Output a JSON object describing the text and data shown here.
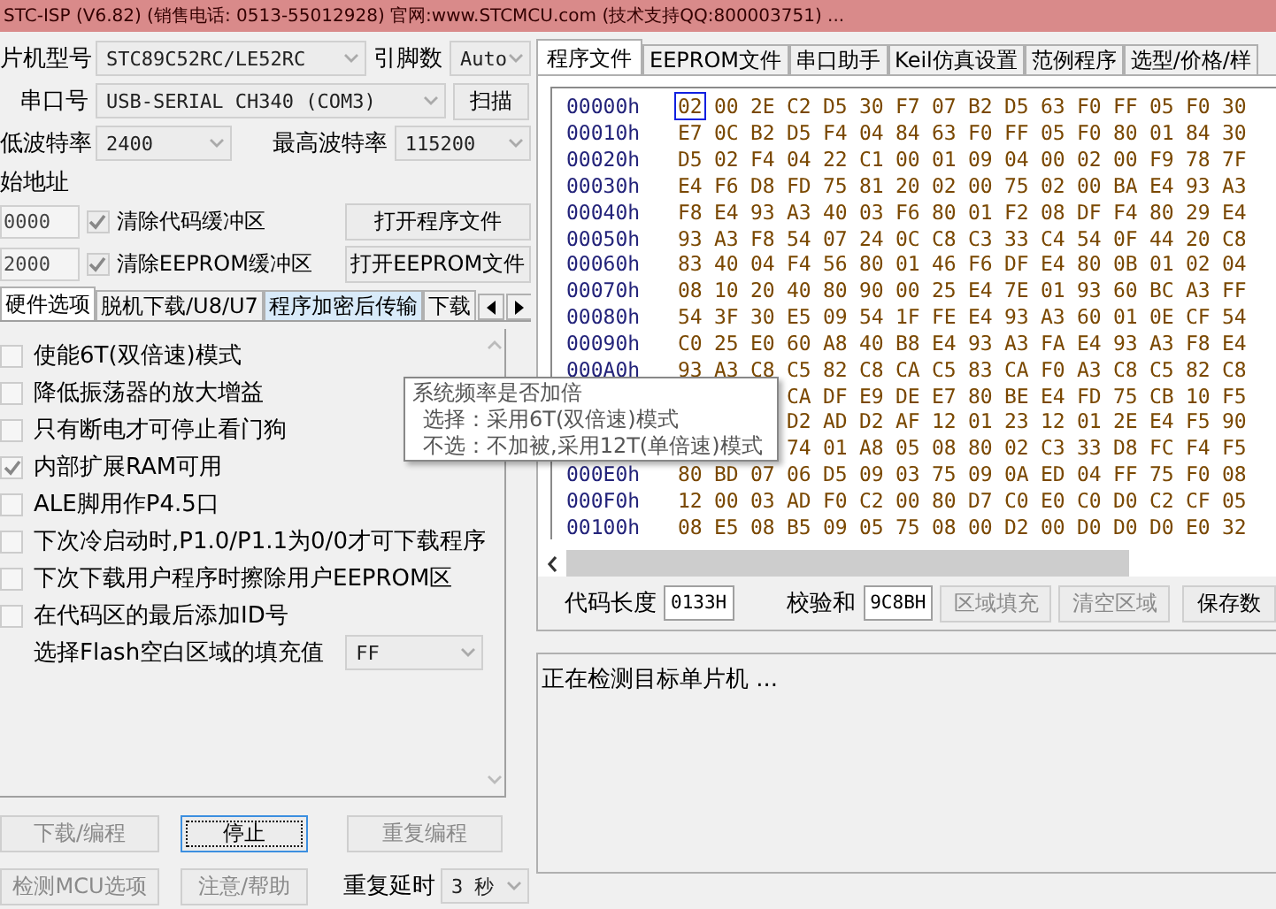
{
  "title": "STC-ISP (V6.82) (销售电话: 0513-55012928) 官网:www.STCMCU.com (技术支持QQ:800003751) ...",
  "chip": {
    "label": "片机型号",
    "value": "STC89C52RC/LE52RC"
  },
  "pins": {
    "label": "引脚数",
    "value": "Auto"
  },
  "port": {
    "label": "串口号",
    "value": "USB-SERIAL CH340 (COM3)",
    "button": "扫描"
  },
  "min_baud": {
    "label": "低波特率",
    "value": "2400"
  },
  "max_baud": {
    "label": "最高波特率",
    "value": "115200"
  },
  "start_address": {
    "label": "始地址",
    "rows": [
      {
        "value": "0000",
        "option": "清除代码缓冲区",
        "checked": true,
        "button": "打开程序文件"
      },
      {
        "value": "2000",
        "option": "清除EEPROM缓冲区",
        "checked": true,
        "button": "打开EEPROM文件"
      }
    ]
  },
  "left_tabs": [
    {
      "label": "硬件选项",
      "selected": true,
      "hovered": false
    },
    {
      "label": "脱机下载/U8/U7",
      "selected": false,
      "hovered": false
    },
    {
      "label": "程序加密后传输",
      "selected": false,
      "hovered": true
    },
    {
      "label": "下载",
      "selected": false,
      "hovered": false
    }
  ],
  "options": [
    {
      "kind": "checkbox",
      "label": "使能6T(双倍速)模式",
      "checked": false
    },
    {
      "kind": "checkbox",
      "label": "降低振荡器的放大增益",
      "checked": false
    },
    {
      "kind": "checkbox",
      "label": "只有断电才可停止看门狗",
      "checked": false
    },
    {
      "kind": "checkbox",
      "label": "内部扩展RAM可用",
      "checked": true
    },
    {
      "kind": "checkbox",
      "label": "ALE脚用作P4.5口",
      "checked": false
    },
    {
      "kind": "checkbox",
      "label": "下次冷启动时,P1.0/P1.1为0/0才可下载程序",
      "checked": false
    },
    {
      "kind": "checkbox",
      "label": "下次下载用户程序时擦除用户EEPROM区",
      "checked": false
    },
    {
      "kind": "checkbox",
      "label": "在代码区的最后添加ID号",
      "checked": false
    },
    {
      "kind": "select",
      "label": "选择Flash空白区域的填充值",
      "value": "FF"
    }
  ],
  "tooltip": {
    "title": "系统频率是否加倍",
    "lines": [
      "选择：采用6T(双倍速)模式",
      "不选：不加被,采用12T(单倍速)模式"
    ]
  },
  "actions": [
    {
      "label": "下载/编程",
      "disabled": true,
      "focused": false
    },
    {
      "label": "停止",
      "disabled": false,
      "focused": true
    },
    {
      "label": "重复编程",
      "disabled": true,
      "focused": false
    },
    {
      "label": "检测MCU选项",
      "disabled": true,
      "focused": false
    },
    {
      "label": "注意/帮助",
      "disabled": true,
      "focused": false
    }
  ],
  "repeat_delay": {
    "label": "重复延时",
    "value": "3 秒"
  },
  "right_tabs": [
    {
      "label": "程序文件",
      "selected": true
    },
    {
      "label": "EEPROM文件",
      "selected": false
    },
    {
      "label": "串口助手",
      "selected": false
    },
    {
      "label": "Keil仿真设置",
      "selected": false
    },
    {
      "label": "范例程序",
      "selected": false
    },
    {
      "label": "选型/价格/样",
      "selected": false
    }
  ],
  "hex": {
    "rows": [
      {
        "offset": "00000h",
        "cursor": true,
        "cells": [
          "02",
          "00",
          "2E",
          "C2",
          "D5",
          "30",
          "F7",
          "07",
          "B2",
          "D5",
          "63",
          "F0",
          "FF",
          "05",
          "F0",
          "30"
        ]
      },
      {
        "offset": "00010h",
        "cursor": false,
        "cells": [
          "E7",
          "0C",
          "B2",
          "D5",
          "F4",
          "04",
          "84",
          "63",
          "F0",
          "FF",
          "05",
          "F0",
          "80",
          "01",
          "84",
          "30"
        ]
      },
      {
        "offset": "00020h",
        "cursor": false,
        "cells": [
          "D5",
          "02",
          "F4",
          "04",
          "22",
          "C1",
          "00",
          "01",
          "09",
          "04",
          "00",
          "02",
          "00",
          "F9",
          "78",
          "7F"
        ]
      },
      {
        "offset": "00030h",
        "cursor": false,
        "cells": [
          "E4",
          "F6",
          "D8",
          "FD",
          "75",
          "81",
          "20",
          "02",
          "00",
          "75",
          "02",
          "00",
          "BA",
          "E4",
          "93",
          "A3"
        ]
      },
      {
        "offset": "00040h",
        "cursor": false,
        "cells": [
          "F8",
          "E4",
          "93",
          "A3",
          "40",
          "03",
          "F6",
          "80",
          "01",
          "F2",
          "08",
          "DF",
          "F4",
          "80",
          "29",
          "E4"
        ]
      },
      {
        "offset": "00050h",
        "cursor": false,
        "cells": [
          "93",
          "A3",
          "F8",
          "54",
          "07",
          "24",
          "0C",
          "C8",
          "C3",
          "33",
          "C4",
          "54",
          "0F",
          "44",
          "20",
          "C8"
        ]
      },
      {
        "offset": "00060h",
        "cursor": false,
        "cells": [
          "83",
          "40",
          "04",
          "F4",
          "56",
          "80",
          "01",
          "46",
          "F6",
          "DF",
          "E4",
          "80",
          "0B",
          "01",
          "02",
          "04"
        ]
      },
      {
        "offset": "00070h",
        "cursor": false,
        "cells": [
          "08",
          "10",
          "20",
          "40",
          "80",
          "90",
          "00",
          "25",
          "E4",
          "7E",
          "01",
          "93",
          "60",
          "BC",
          "A3",
          "FF"
        ]
      },
      {
        "offset": "00080h",
        "cursor": false,
        "cells": [
          "54",
          "3F",
          "30",
          "E5",
          "09",
          "54",
          "1F",
          "FE",
          "E4",
          "93",
          "A3",
          "60",
          "01",
          "0E",
          "CF",
          "54"
        ]
      },
      {
        "offset": "00090h",
        "cursor": false,
        "cells": [
          "C0",
          "25",
          "E0",
          "60",
          "A8",
          "40",
          "B8",
          "E4",
          "93",
          "A3",
          "FA",
          "E4",
          "93",
          "A3",
          "F8",
          "E4"
        ]
      },
      {
        "offset": "000A0h",
        "cursor": false,
        "cells": [
          "93",
          "A3",
          "C8",
          "C5",
          "82",
          "C8",
          "CA",
          "C5",
          "83",
          "CA",
          "F0",
          "A3",
          "C8",
          "C5",
          "82",
          "C8"
        ]
      },
      {
        "cursor": false,
        "cells": [
          "CA",
          "DF",
          "E9",
          "DE",
          "E7",
          "80",
          "BE",
          "E4",
          "FD",
          "75",
          "CB",
          "10",
          "F5"
        ]
      },
      {
        "cursor": false,
        "cells": [
          "D2",
          "AD",
          "D2",
          "AF",
          "12",
          "01",
          "23",
          "12",
          "01",
          "2E",
          "E4",
          "F5",
          "90"
        ]
      },
      {
        "cursor": false,
        "cells": [
          "74",
          "01",
          "A8",
          "05",
          "08",
          "80",
          "02",
          "C3",
          "33",
          "D8",
          "FC",
          "F4",
          "F5"
        ]
      },
      {
        "offset": "000E0h",
        "cursor": false,
        "cells": [
          "80",
          "BD",
          "07",
          "06",
          "D5",
          "09",
          "03",
          "75",
          "09",
          "0A",
          "ED",
          "04",
          "FF",
          "75",
          "F0",
          "08"
        ]
      },
      {
        "offset": "000F0h",
        "cursor": false,
        "cells": [
          "12",
          "00",
          "03",
          "AD",
          "F0",
          "C2",
          "00",
          "80",
          "D7",
          "C0",
          "E0",
          "C0",
          "D0",
          "C2",
          "CF",
          "05"
        ]
      },
      {
        "offset": "00100h",
        "cursor": false,
        "cells": [
          "08",
          "E5",
          "08",
          "B5",
          "09",
          "05",
          "75",
          "08",
          "00",
          "D2",
          "00",
          "D0",
          "D0",
          "D0",
          "E0",
          "32"
        ]
      }
    ]
  },
  "code_length": {
    "label": "代码长度",
    "value": "0133H"
  },
  "checksum": {
    "label": "校验和",
    "value": "9C8BH"
  },
  "hex_buttons": [
    {
      "label": "区域填充",
      "disabled": true
    },
    {
      "label": "清空区域",
      "disabled": true
    },
    {
      "label": "保存数",
      "disabled": false
    }
  ],
  "log": "正在检测目标单片机 ..."
}
